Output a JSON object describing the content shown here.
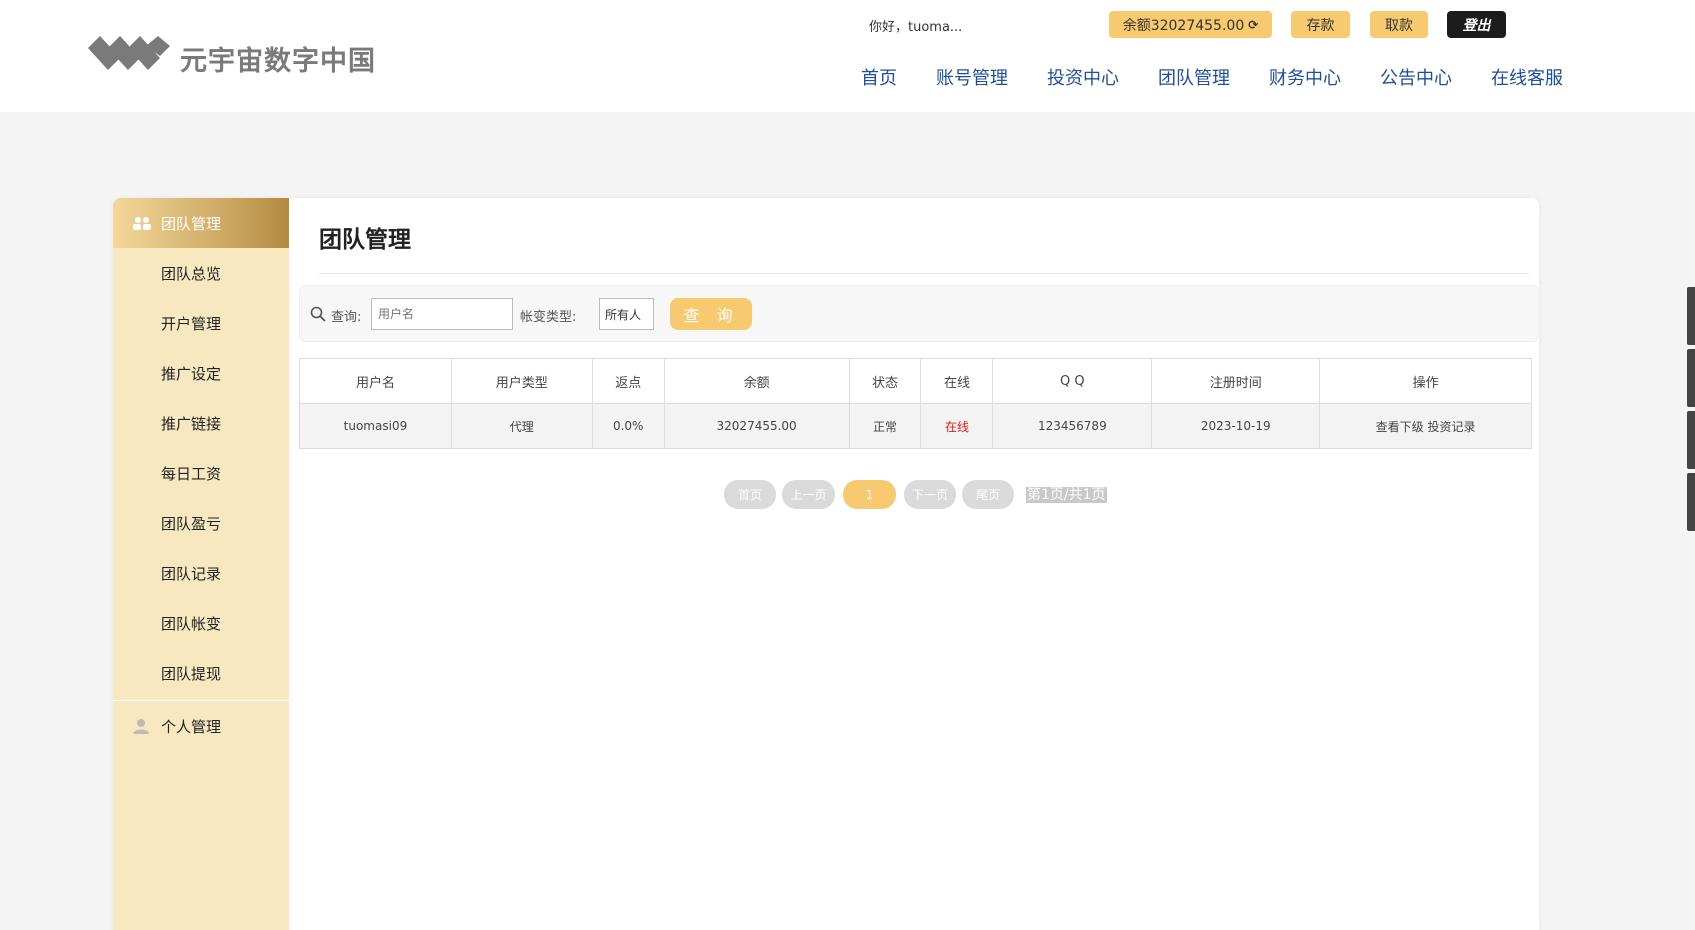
{
  "header": {
    "logo_text": "元宇宙数字中国",
    "greeting": "你好，tuoma...",
    "balance_label": "余额32027455.00",
    "deposit_label": "存款",
    "withdraw_label": "取款",
    "logout_label": "登出",
    "nav": [
      "首页",
      "账号管理",
      "投资中心",
      "团队管理",
      "财务中心",
      "公告中心",
      "在线客服"
    ]
  },
  "sidebar": {
    "header_label": "团队管理",
    "items": [
      "团队总览",
      "开户管理",
      "推广设定",
      "推广链接",
      "每日工资",
      "团队盈亏",
      "团队记录",
      "团队帐变",
      "团队提现"
    ],
    "personal_label": "个人管理"
  },
  "main": {
    "title": "团队管理",
    "filter": {
      "query_label": "查询:",
      "username_placeholder": "用户名",
      "type_label": "帐变类型:",
      "type_value": "所有人",
      "query_button": "查 询"
    },
    "table": {
      "headers": [
        "用户名",
        "用户类型",
        "返点",
        "余额",
        "状态",
        "在线",
        "Q Q",
        "注册时间",
        "操作"
      ],
      "rows": [
        {
          "username": "tuomasi09",
          "type": "代理",
          "rebate": "0.0%",
          "balance": "32027455.00",
          "status": "正常",
          "online": "在线",
          "qq": "123456789",
          "reg_time": "2023-10-19",
          "actions": "查看下级 投资记录"
        }
      ]
    },
    "pager": {
      "first": "首页",
      "prev": "上一页",
      "current": "1",
      "next": "下一页",
      "last": "尾页",
      "info": "第1页/共1页"
    }
  },
  "colors": {
    "accent": "#f7ca6f",
    "nav_text": "#1f4e9c",
    "sidebar_bg": "#f7e8c0",
    "online_red": "#e01b1b"
  }
}
